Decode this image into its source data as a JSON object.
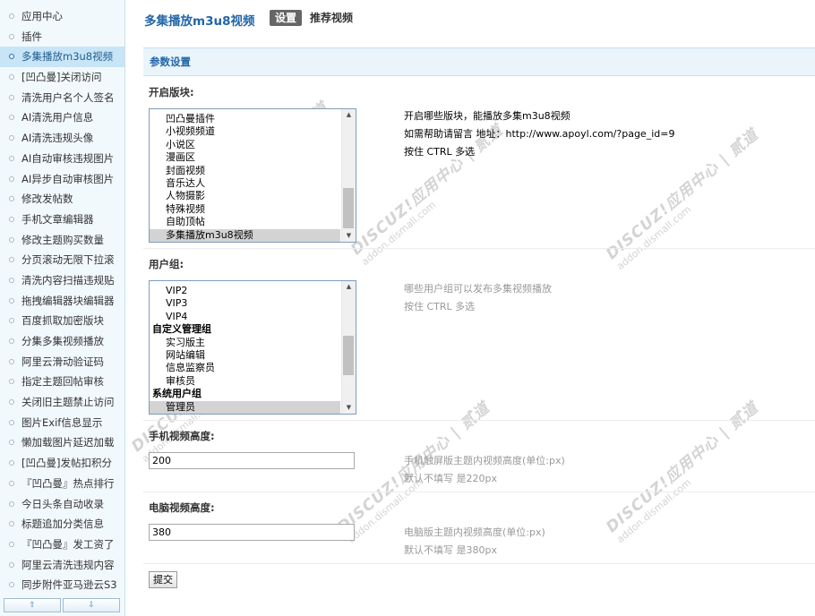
{
  "sidebar": {
    "items": [
      "应用中心",
      "插件",
      "多集播放m3u8视频",
      "[凹凸曼]关闭访问",
      "清洗用户名个人签名",
      "AI清洗用户信息",
      "AI清洗违规头像",
      "AI自动审核违规图片",
      "AI异步自动审核图片",
      "修改发帖数",
      "手机文章编辑器",
      "修改主题购买数量",
      "分页滚动无限下拉滚",
      "清洗内容扫描违规贴",
      "拖拽编辑器块编辑器",
      "百度抓取加密版块",
      "分集多集视频播放",
      "阿里云滑动验证码",
      "指定主题回帖审核",
      "关闭旧主题禁止访问",
      "图片Exif信息显示",
      "懒加载图片延迟加载",
      "[凹凸曼]发帖扣积分",
      "『凹凸曼』热点排行",
      "今日头条自动收录",
      "标题追加分类信息",
      "『凹凸曼』发工资了",
      "阿里云清洗违规内容",
      "同步附件亚马逊云S3"
    ],
    "active_index": 2,
    "scroll_up": "⇧",
    "scroll_down": "⇩"
  },
  "header": {
    "title": "多集播放m3u8视频",
    "tabs": [
      "设置",
      "推荐视频"
    ],
    "active_tab": 0
  },
  "section": {
    "title": "参数设置"
  },
  "form": {
    "forums": {
      "label": "开启版块:",
      "options": [
        {
          "text": "凹凸曼插件",
          "group": false,
          "selected": false
        },
        {
          "text": "小视频频道",
          "group": false,
          "selected": false
        },
        {
          "text": "小说区",
          "group": false,
          "selected": false
        },
        {
          "text": "漫画区",
          "group": false,
          "selected": false
        },
        {
          "text": "封面视频",
          "group": false,
          "selected": false
        },
        {
          "text": "音乐达人",
          "group": false,
          "selected": false
        },
        {
          "text": "人物摄影",
          "group": false,
          "selected": false
        },
        {
          "text": "特殊视频",
          "group": false,
          "selected": false
        },
        {
          "text": "自助顶帖",
          "group": false,
          "selected": false
        },
        {
          "text": "多集播放m3u8视频",
          "group": false,
          "selected": true
        }
      ],
      "tip_lines": [
        "开启哪些版块，能播放多集m3u8视频",
        "如需帮助请留言 地址：http://www.apoyl.com/?page_id=9",
        "按住 CTRL 多选"
      ]
    },
    "usergroups": {
      "label": "用户组:",
      "options": [
        {
          "text": "VIP2",
          "group": false,
          "selected": false
        },
        {
          "text": "VIP3",
          "group": false,
          "selected": false
        },
        {
          "text": "VIP4",
          "group": false,
          "selected": false
        },
        {
          "text": "自定义管理组",
          "group": true,
          "selected": false
        },
        {
          "text": "实习版主",
          "group": false,
          "selected": false
        },
        {
          "text": "网站编辑",
          "group": false,
          "selected": false
        },
        {
          "text": "信息监察员",
          "group": false,
          "selected": false
        },
        {
          "text": "审核员",
          "group": false,
          "selected": false
        },
        {
          "text": "系统用户组",
          "group": true,
          "selected": false
        },
        {
          "text": "管理员",
          "group": false,
          "selected": true
        }
      ],
      "tip_lines": [
        "哪些用户组可以发布多集视频播放",
        "按住 CTRL 多选"
      ]
    },
    "mobile_height": {
      "label": "手机视频高度:",
      "value": "200",
      "tip_lines": [
        "手机触屏版主题内视频高度(单位:px)",
        "默认不填写 是220px"
      ]
    },
    "pc_height": {
      "label": "电脑视频高度:",
      "value": "380",
      "tip_lines": [
        "电脑版主题内视频高度(单位:px)",
        "默认不填写 是380px"
      ]
    },
    "submit_label": "提交"
  },
  "watermark": {
    "brand": "DISCUZ!应用中心 | 贰道",
    "domain": "addon.dismall.com"
  }
}
